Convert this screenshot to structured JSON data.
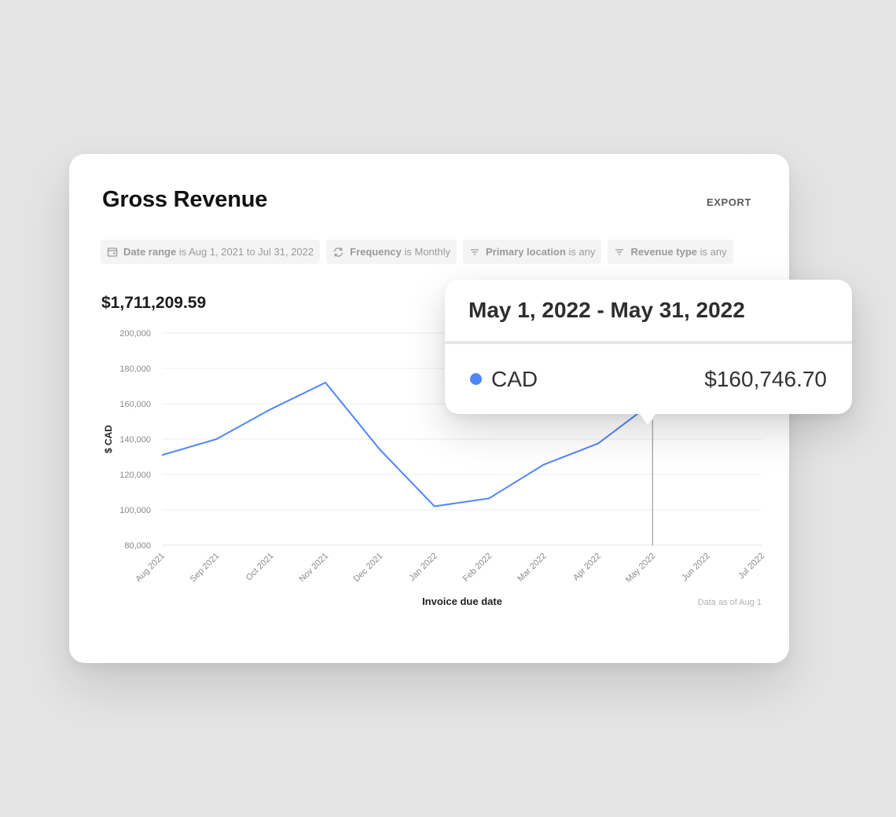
{
  "card": {
    "title": "Gross Revenue",
    "export_label": "EXPORT",
    "total": "$1,711,209.59",
    "filters": [
      {
        "icon": "calendar-icon",
        "key": "Date range",
        "rest": " is Aug 1, 2021 to Jul 31, 2022"
      },
      {
        "icon": "refresh-icon",
        "key": "Frequency",
        "rest": " is Monthly"
      },
      {
        "icon": "filter-icon",
        "key": "Primary location",
        "rest": " is any"
      },
      {
        "icon": "filter-icon",
        "key": "Revenue type",
        "rest": " is any"
      }
    ],
    "footnote": "Data as of Aug 1"
  },
  "tooltip": {
    "title": "May 1, 2022 - May 31, 2022",
    "series_label": "CAD",
    "value": "$160,746.70"
  },
  "colors": {
    "line": "#4f86f7",
    "grid": "#ececec",
    "crosshair": "#8a8a8a"
  },
  "chart_data": {
    "type": "line",
    "title": "Gross Revenue",
    "xlabel": "Invoice due date",
    "ylabel": "$ CAD",
    "categories": [
      "Aug 2021",
      "Sep 2021",
      "Oct 2021",
      "Nov 2021",
      "Dec 2021",
      "Jan 2022",
      "Feb 2022",
      "Mar 2022",
      "Apr 2022",
      "May 2022",
      "Jun 2022",
      "Jul 2022"
    ],
    "series": [
      {
        "name": "CAD",
        "values": [
          131000,
          140000,
          157000,
          172000,
          134000,
          102000,
          106500,
          125500,
          137500,
          160746.7,
          null,
          null
        ]
      }
    ],
    "ylim": [
      80000,
      200000
    ],
    "yticks": [
      200000,
      180000,
      160000,
      140000,
      120000,
      100000,
      80000
    ],
    "ytick_labels": [
      "200,000",
      "180,000",
      "160,000",
      "140,000",
      "120,000",
      "100,000",
      "80,000"
    ],
    "grid": true,
    "highlighted_category": "May 2022"
  }
}
